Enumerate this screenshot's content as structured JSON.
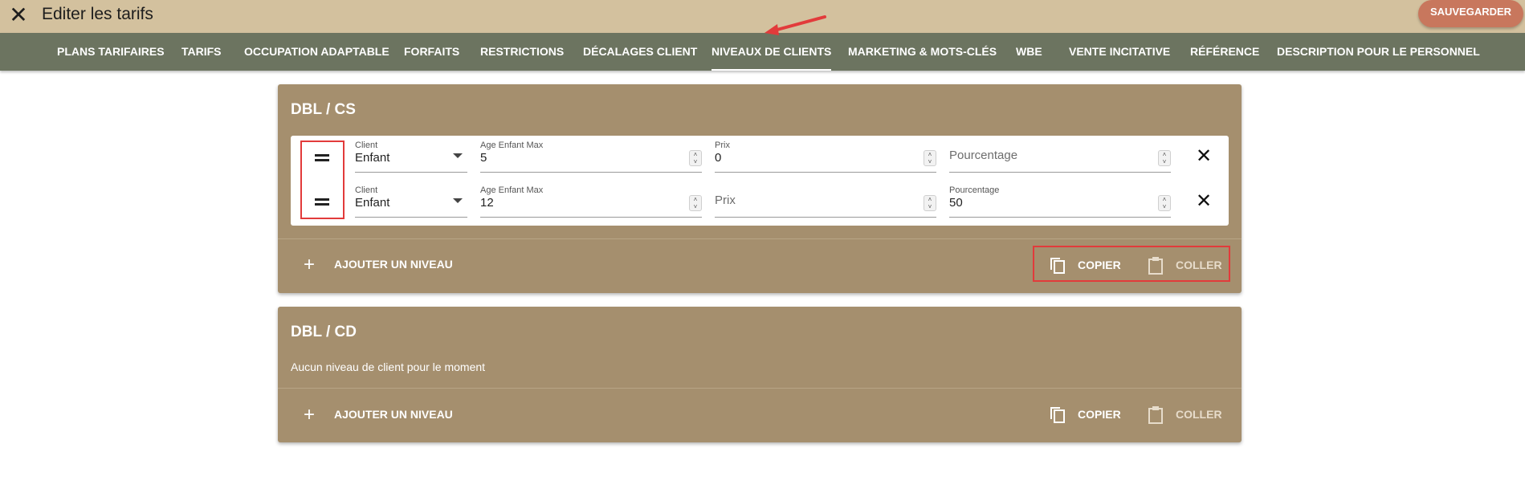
{
  "header": {
    "close_icon": "close-icon",
    "title": "Editer les tarifs",
    "save_label": "SAUVEGARDER"
  },
  "tabs": [
    {
      "label": "PLANS TARIFAIRES",
      "active": false
    },
    {
      "label": "TARIFS",
      "active": false
    },
    {
      "label": "OCCUPATION ADAPTABLE",
      "active": false
    },
    {
      "label": "FORFAITS",
      "active": false
    },
    {
      "label": "RESTRICTIONS",
      "active": false
    },
    {
      "label": "DÉCALAGES CLIENT",
      "active": false
    },
    {
      "label": "NIVEAUX DE CLIENTS",
      "active": true
    },
    {
      "label": "MARKETING & MOTS-CLÉS",
      "active": false
    },
    {
      "label": "WBE",
      "active": false
    },
    {
      "label": "VENTE INCITATIVE",
      "active": false
    },
    {
      "label": "RÉFÉRENCE",
      "active": false
    },
    {
      "label": "DESCRIPTION POUR LE PERSONNEL",
      "active": false
    }
  ],
  "cards": [
    {
      "title": "DBL / CS",
      "rows": [
        {
          "client": {
            "label": "Client",
            "value": "Enfant"
          },
          "age": {
            "label": "Age Enfant Max",
            "value": "5"
          },
          "prix": {
            "label": "Prix",
            "value": "0",
            "placeholder": "Prix"
          },
          "pourcentage": {
            "label": "Pourcentage",
            "value": "",
            "placeholder": "Pourcentage"
          }
        },
        {
          "client": {
            "label": "Client",
            "value": "Enfant"
          },
          "age": {
            "label": "Age Enfant Max",
            "value": "12"
          },
          "prix": {
            "label": "Prix",
            "value": "",
            "placeholder": "Prix"
          },
          "pourcentage": {
            "label": "Pourcentage",
            "value": "50",
            "placeholder": "Pourcentage"
          }
        }
      ],
      "add_label": "AJOUTER UN NIVEAU",
      "copy_label": "COPIER",
      "paste_label": "COLLER"
    },
    {
      "title": "DBL / CD",
      "empty_text": "Aucun niveau de client pour le moment",
      "add_label": "AJOUTER UN NIVEAU",
      "copy_label": "COPIER",
      "paste_label": "COLLER"
    }
  ],
  "colors": {
    "header_bg": "#d3c19e",
    "nav_bg": "#6c7460",
    "card_bg": "#a58f6e",
    "save_bg": "#c8775d",
    "highlight": "#e23b3b"
  }
}
